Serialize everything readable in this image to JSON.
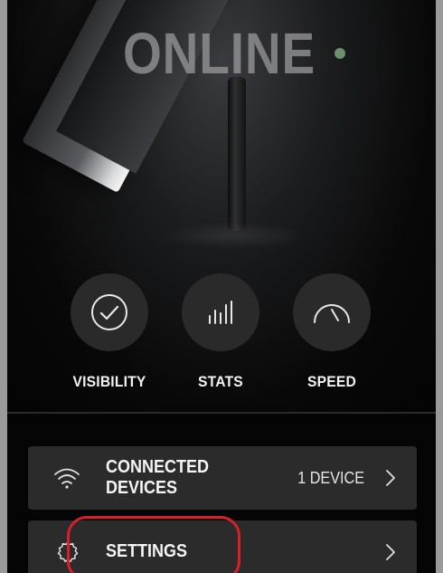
{
  "status": {
    "text": "ONLINE",
    "dot_color": "#6d8f6d"
  },
  "actions": [
    {
      "label": "VISIBILITY",
      "icon": "check-circle-icon"
    },
    {
      "label": "STATS",
      "icon": "bar-stats-icon"
    },
    {
      "label": "SPEED",
      "icon": "speedometer-icon"
    }
  ],
  "rows": [
    {
      "label_line1": "CONNECTED",
      "label_line2": "DEVICES",
      "value": "1 DEVICE",
      "icon": "wifi-icon"
    },
    {
      "label": "SETTINGS",
      "icon": "gear-icon"
    }
  ],
  "colors": {
    "background": "#050505",
    "row_bg": "#2b2b2b",
    "highlight": "#d9202a"
  }
}
